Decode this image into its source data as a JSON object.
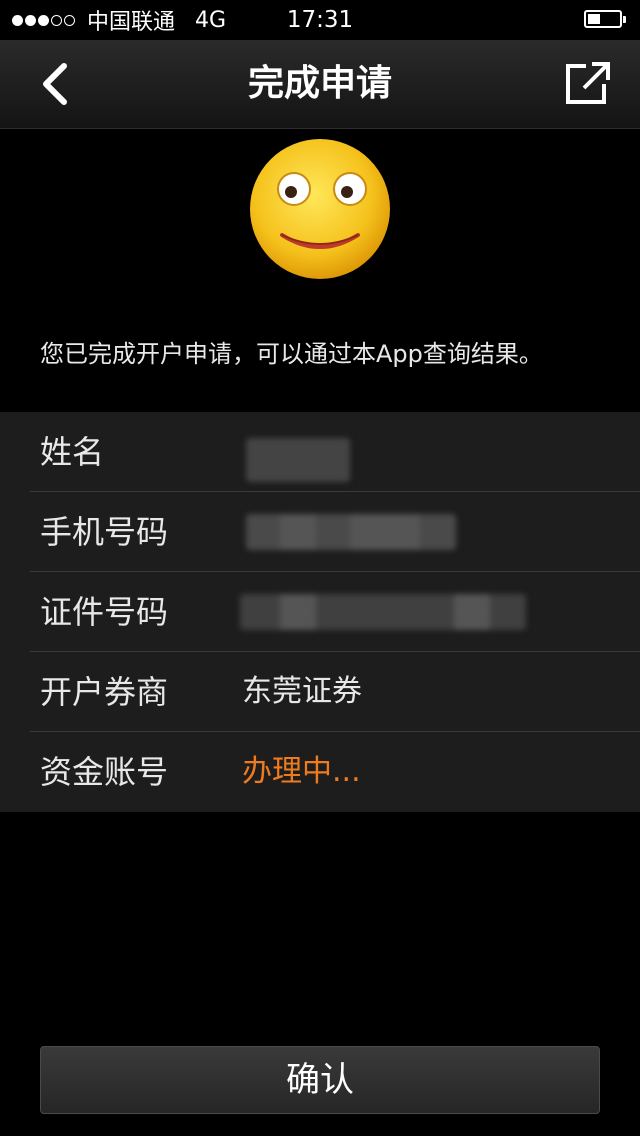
{
  "status_bar": {
    "carrier": "中国联通",
    "network": "4G",
    "time": "17:31"
  },
  "nav": {
    "title": "完成申请"
  },
  "hero": {
    "icon": "smiling-face-icon",
    "message": "您已完成开户申请，可以通过本App查询结果。"
  },
  "info": {
    "rows": [
      {
        "label": "姓名",
        "value": ""
      },
      {
        "label": "手机号码",
        "value": ""
      },
      {
        "label": "证件号码",
        "value": ""
      },
      {
        "label": "开户券商",
        "value": "东莞证券"
      },
      {
        "label": "资金账号",
        "value": "办理中..."
      }
    ]
  },
  "actions": {
    "confirm_label": "确认"
  },
  "colors": {
    "pending": "#ee7b1d",
    "background": "#000000",
    "list_background": "#1d1d1d"
  }
}
